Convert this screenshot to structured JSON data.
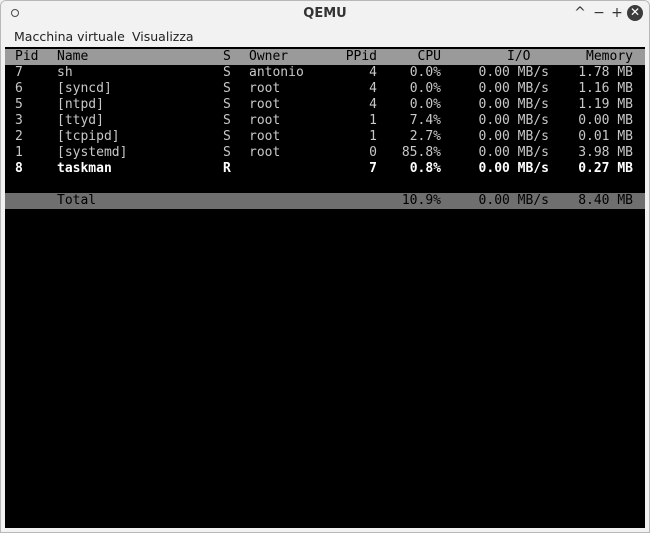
{
  "window": {
    "title": "QEMU",
    "controls": {
      "minimize": "^",
      "dash": "−",
      "maximize": "+",
      "close": "✕"
    }
  },
  "menu": [
    "Macchina virtuale",
    "Visualizza"
  ],
  "table": {
    "headers": {
      "pid": "Pid",
      "name": "Name",
      "s": "S",
      "owner": "Owner",
      "ppid": "PPid",
      "cpu": "CPU",
      "io": "I/O",
      "memory": "Memory"
    },
    "rows": [
      {
        "pid": "7",
        "name": "sh",
        "s": "S",
        "owner": "antonio",
        "ppid": "4",
        "cpu": "0.0%",
        "io": "0.00 MB/s",
        "memory": "1.78 MB"
      },
      {
        "pid": "6",
        "name": "[syncd]",
        "s": "S",
        "owner": "root",
        "ppid": "4",
        "cpu": "0.0%",
        "io": "0.00 MB/s",
        "memory": "1.16 MB"
      },
      {
        "pid": "5",
        "name": "[ntpd]",
        "s": "S",
        "owner": "root",
        "ppid": "4",
        "cpu": "0.0%",
        "io": "0.00 MB/s",
        "memory": "1.19 MB"
      },
      {
        "pid": "3",
        "name": "[ttyd]",
        "s": "S",
        "owner": "root",
        "ppid": "1",
        "cpu": "7.4%",
        "io": "0.00 MB/s",
        "memory": "0.00 MB"
      },
      {
        "pid": "2",
        "name": "[tcpipd]",
        "s": "S",
        "owner": "root",
        "ppid": "1",
        "cpu": "2.7%",
        "io": "0.00 MB/s",
        "memory": "0.01 MB"
      },
      {
        "pid": "1",
        "name": "[systemd]",
        "s": "S",
        "owner": "root",
        "ppid": "0",
        "cpu": "85.8%",
        "io": "0.00 MB/s",
        "memory": "3.98 MB"
      },
      {
        "pid": "8",
        "name": "taskman",
        "s": "R",
        "owner": "",
        "ppid": "7",
        "cpu": "0.8%",
        "io": "0.00 MB/s",
        "memory": "0.27 MB"
      }
    ],
    "total": {
      "label": "Total",
      "cpu": "10.9%",
      "io": "0.00 MB/s",
      "memory": "8.40 MB"
    }
  },
  "colors": {
    "terminal_bg": "#000000",
    "header_bg": "#9a9a9a",
    "total_bg": "#6f6f6f",
    "text": "#c8c8c8",
    "highlight": "#ffffff"
  }
}
